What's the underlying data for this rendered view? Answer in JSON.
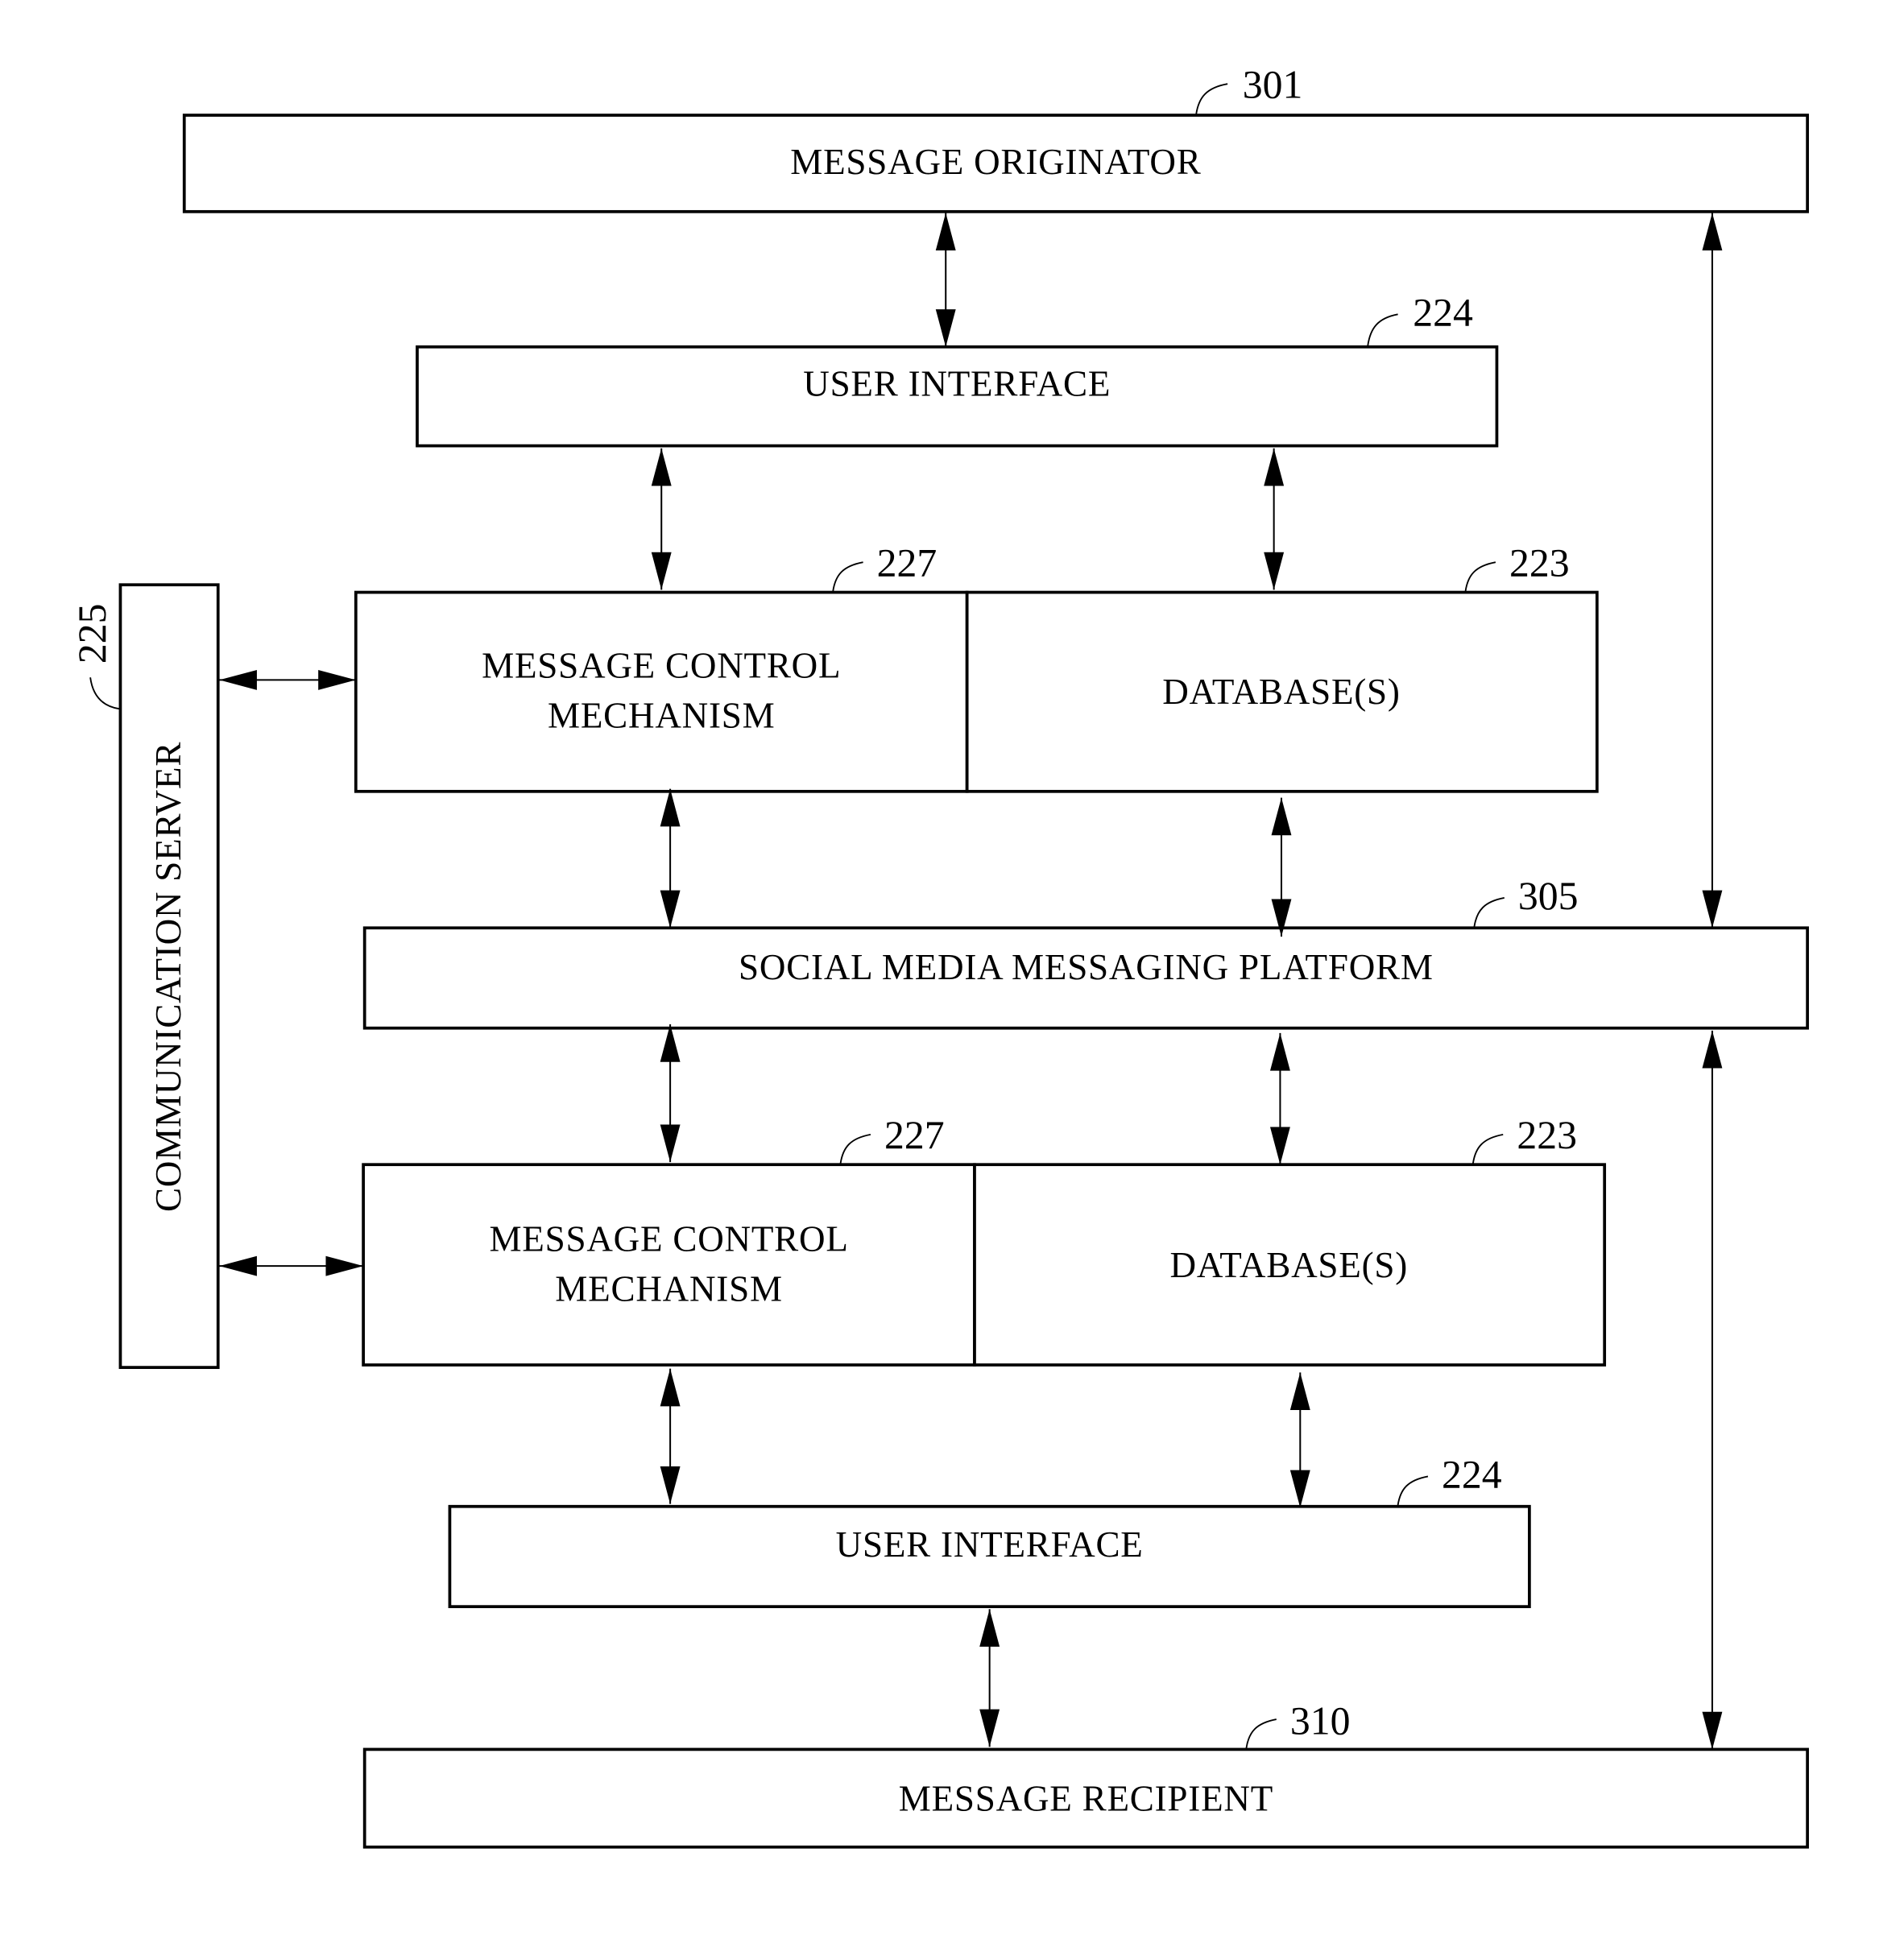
{
  "diagram": {
    "blocks": {
      "message_originator": {
        "label": "MESSAGE ORIGINATOR",
        "ref": "301"
      },
      "user_interface_top": {
        "label": "USER INTERFACE",
        "ref": "224"
      },
      "message_control_top": {
        "label_line1": "MESSAGE CONTROL",
        "label_line2": "MECHANISM",
        "ref": "227"
      },
      "databases_top": {
        "label": "DATABASE(S)",
        "ref": "223"
      },
      "communication_server": {
        "label": "COMMUNICATION  SERVER",
        "ref": "225"
      },
      "social_media_platform": {
        "label": "SOCIAL MEDIA MESSAGING PLATFORM",
        "ref": "305"
      },
      "message_control_bottom": {
        "label_line1": "MESSAGE CONTROL",
        "label_line2": "MECHANISM",
        "ref": "227"
      },
      "databases_bottom": {
        "label": "DATABASE(S)",
        "ref": "223"
      },
      "user_interface_bottom": {
        "label": "USER INTERFACE",
        "ref": "224"
      },
      "message_recipient": {
        "label": "MESSAGE RECIPIENT",
        "ref": "310"
      }
    },
    "connections": [
      {
        "from": "message_originator",
        "to": "user_interface_top",
        "direction": "bidirectional"
      },
      {
        "from": "message_originator",
        "to": "social_media_platform",
        "direction": "bidirectional"
      },
      {
        "from": "user_interface_top",
        "to": "message_control_top",
        "direction": "bidirectional"
      },
      {
        "from": "user_interface_top",
        "to": "databases_top",
        "direction": "bidirectional"
      },
      {
        "from": "communication_server",
        "to": "message_control_top",
        "direction": "bidirectional"
      },
      {
        "from": "communication_server",
        "to": "message_control_bottom",
        "direction": "bidirectional"
      },
      {
        "from": "message_control_top",
        "to": "social_media_platform",
        "direction": "bidirectional"
      },
      {
        "from": "databases_top",
        "to": "social_media_platform",
        "direction": "bidirectional"
      },
      {
        "from": "social_media_platform",
        "to": "message_control_bottom",
        "direction": "bidirectional"
      },
      {
        "from": "social_media_platform",
        "to": "databases_bottom",
        "direction": "bidirectional"
      },
      {
        "from": "social_media_platform",
        "to": "message_recipient",
        "direction": "bidirectional"
      },
      {
        "from": "message_control_bottom",
        "to": "user_interface_bottom",
        "direction": "bidirectional"
      },
      {
        "from": "databases_bottom",
        "to": "user_interface_bottom",
        "direction": "bidirectional"
      },
      {
        "from": "user_interface_bottom",
        "to": "message_recipient",
        "direction": "bidirectional"
      }
    ]
  }
}
